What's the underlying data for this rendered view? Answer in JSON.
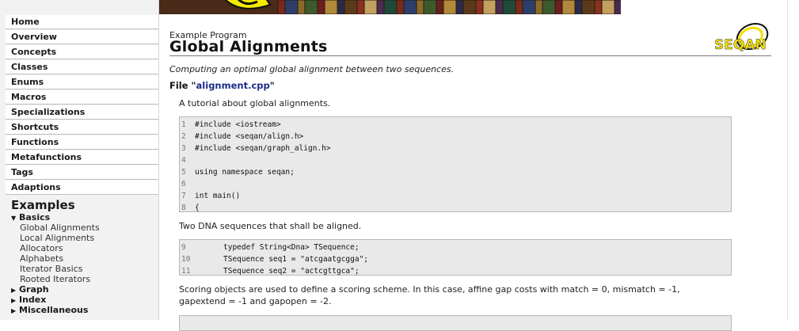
{
  "sidebar": {
    "nav_items": [
      "Home",
      "Overview",
      "Concepts",
      "Classes",
      "Enums",
      "Macros",
      "Specializations",
      "Shortcuts",
      "Functions",
      "Metafunctions",
      "Tags",
      "Adaptions"
    ],
    "examples_heading": "Examples",
    "tree": {
      "basics_label": "Basics",
      "basics_items": [
        "Global Alignments",
        "Local Alignments",
        "Allocators",
        "Alphabets",
        "Iterator Basics",
        "Rooted Iterators"
      ],
      "collapsed_sections": [
        "Graph",
        "Index",
        "Miscellaneous"
      ]
    }
  },
  "page": {
    "kicker": "Example Program",
    "title": "Global Alignments",
    "subtitle": "Computing an optimal global alignment between two sequences.",
    "file_prefix": "File \"",
    "file_name": "alignment.cpp",
    "file_suffix": "\"",
    "tutorial_text": "A tutorial about global alignments.",
    "dna_text": "Two DNA sequences that shall be aligned.",
    "scoring_text_1": "Scoring objects are used to define a scoring scheme. In this case, affine gap costs with match = 0, mismatch = -1,",
    "scoring_text_2": "gapextend = -1 and gapopen = -2.",
    "logo_text": "SEQAN"
  },
  "code_block_1": [
    {
      "n": "1",
      "code": "#include <iostream>"
    },
    {
      "n": "2",
      "code": "#include <seqan/align.h>"
    },
    {
      "n": "3",
      "code": "#include <seqan/graph_align.h>"
    },
    {
      "n": "4",
      "code": ""
    },
    {
      "n": "5",
      "code": "using namespace seqan;"
    },
    {
      "n": "6",
      "code": ""
    },
    {
      "n": "7",
      "code": "int main()"
    },
    {
      "n": "8",
      "code": "{"
    }
  ],
  "code_block_2": [
    {
      "n": "9",
      "code": "typedef String<Dna> TSequence;"
    },
    {
      "n": "10",
      "code": "TSequence seq1 = \"atcgaatgcgga\";"
    },
    {
      "n": "11",
      "code": "TSequence seq2 = \"actcgttgca\";"
    }
  ]
}
